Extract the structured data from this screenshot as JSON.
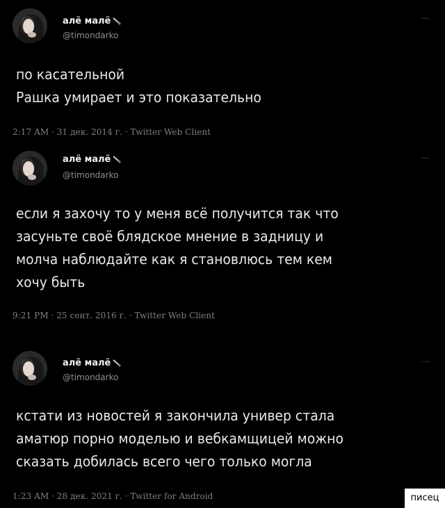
{
  "tweets": [
    {
      "display_name": "алё малё",
      "handle": "@timondarko",
      "more": "...",
      "lines": [
        "по касательной",
        "Рашка умирает и это показательно"
      ],
      "meta": "2:17 AM · 31 дек. 2014 г. · Twitter Web Client"
    },
    {
      "display_name": "алё малё",
      "handle": "@timondarko",
      "more": "...",
      "lines": [
        "если я захочу то у меня всё получится так что",
        "засуньте своё блядское мнение в задницу и",
        "молча наблюдайте как я становлюсь тем кем",
        "хочу быть"
      ],
      "meta": "9:21 PM · 25 сент. 2016 г. · Twitter Web Client"
    },
    {
      "display_name": "алё малё",
      "handle": "@timondarko",
      "more": "...",
      "lines": [
        "кстати из новостей я закончила универ стала",
        "аматюр порно моделью и вебкамщицей можно",
        "сказать добилась всего чего только могла"
      ],
      "meta": "1:23 AM · 28 дек. 2021 г. · Twitter for Android"
    }
  ],
  "watermark": "писец",
  "icons": [
    "avatar",
    "knife-icon",
    "more-icon"
  ]
}
